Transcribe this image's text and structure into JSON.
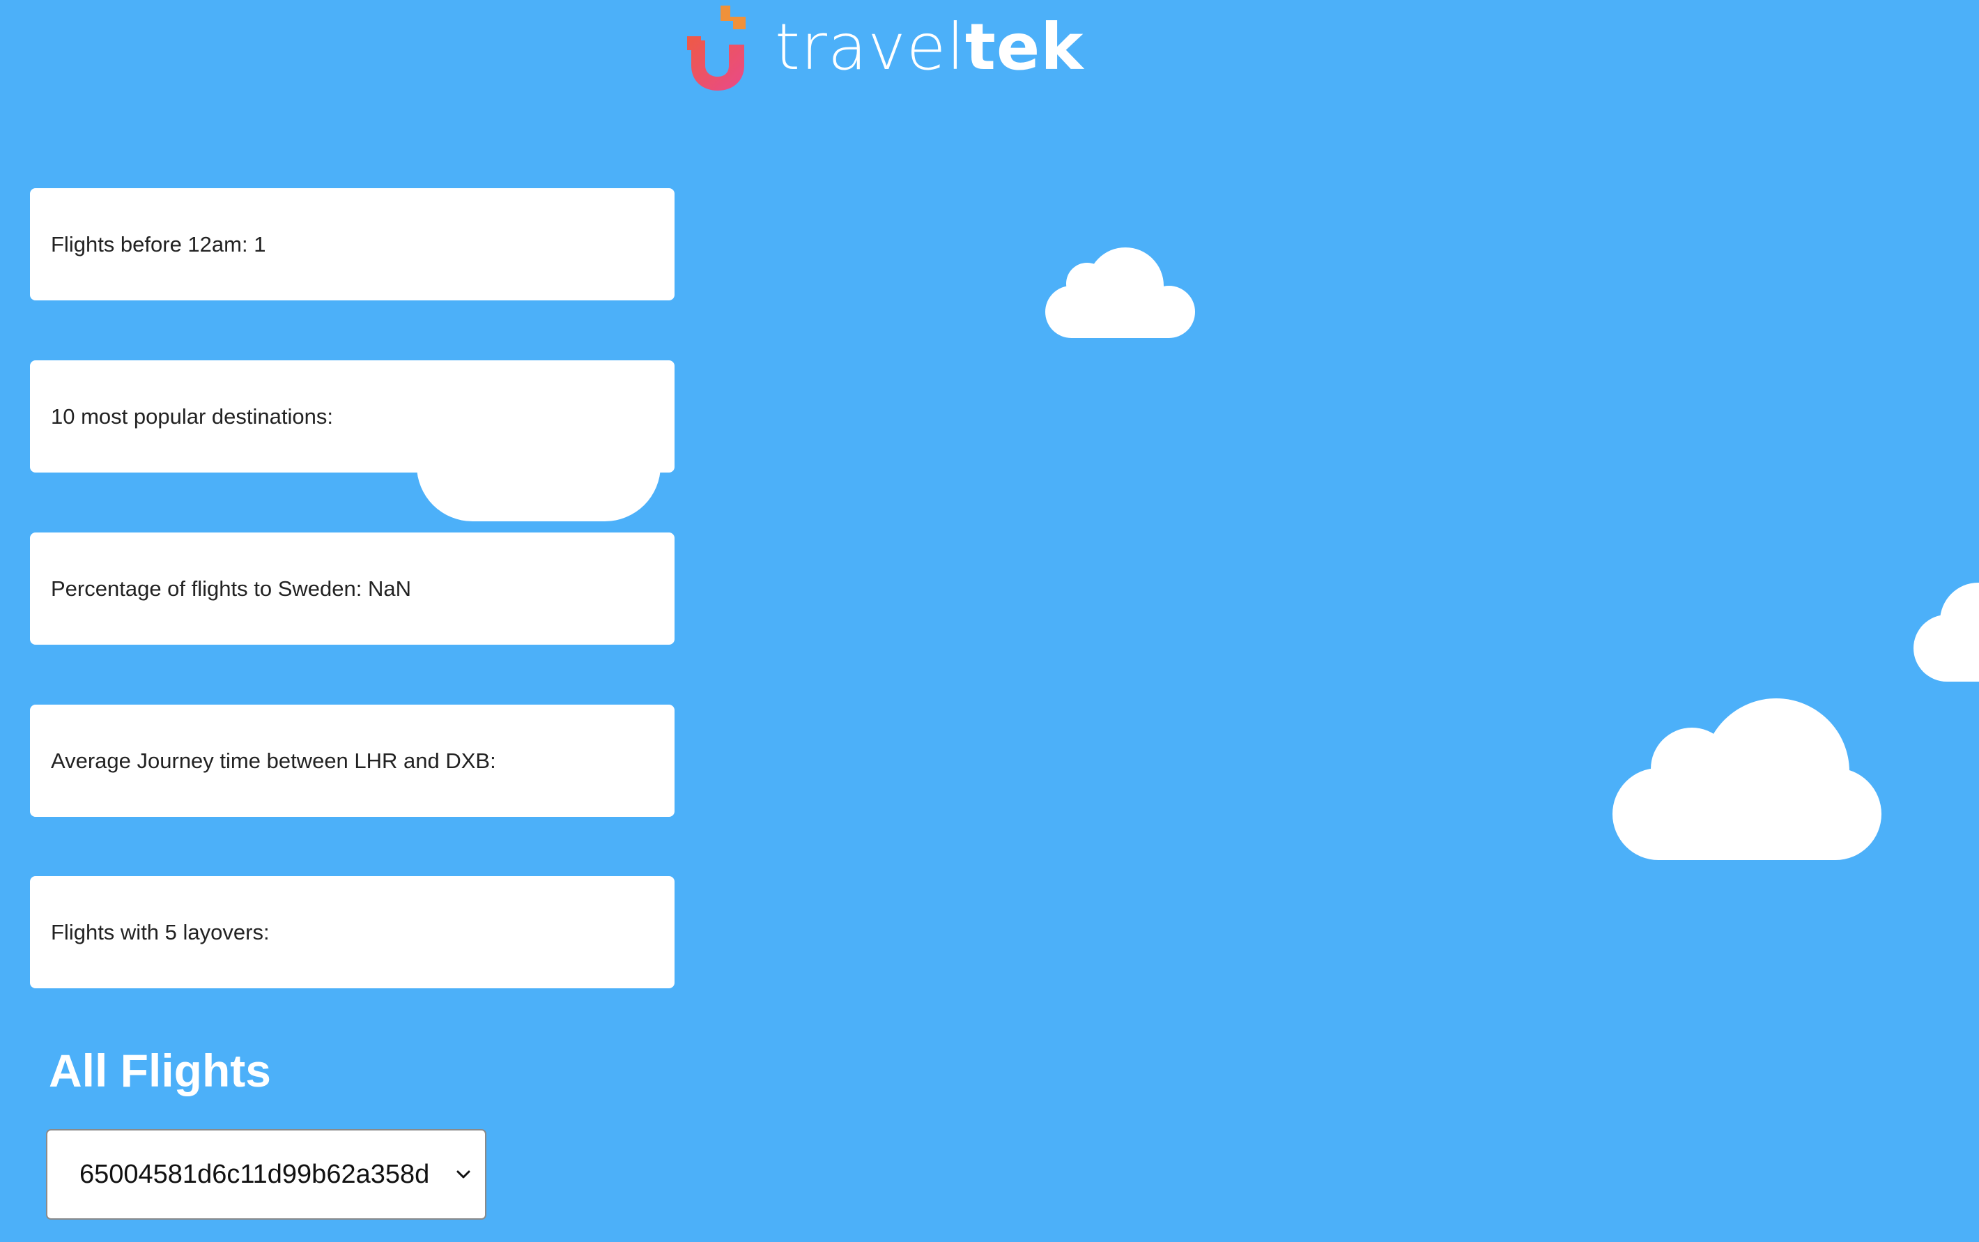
{
  "brand": {
    "name_light": "travel",
    "name_bold": "tek",
    "logo_colors": {
      "orange": "#f0913a",
      "red": "#ee5a45",
      "pink": "#e94a8a"
    }
  },
  "stats": [
    {
      "label": "Flights before 12am: 1"
    },
    {
      "label": "10 most popular destinations:"
    },
    {
      "label": "Percentage of flights to Sweden: NaN"
    },
    {
      "label": "Average Journey time between LHR and DXB:"
    },
    {
      "label": "Flights with 5 layovers:"
    }
  ],
  "flights_section": {
    "title": "All Flights",
    "selected_flight_id": "65004581d6c11d99b62a358d",
    "dropdown_icon": "chevron-down-icon"
  },
  "colors": {
    "background": "#4cb0f9",
    "card": "#ffffff",
    "text": "#222222"
  }
}
